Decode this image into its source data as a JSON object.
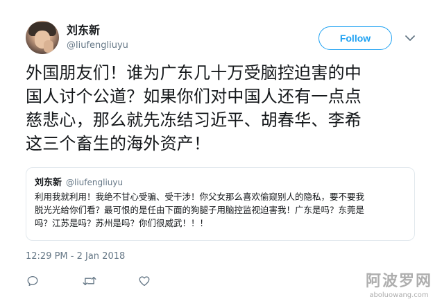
{
  "author": {
    "name": "刘东新",
    "handle": "@liufengliuyu"
  },
  "follow_label": "Follow",
  "tweet": {
    "line1": "外国朋友们！谁为广东几十万受脑控迫害的中",
    "line2": "国人讨个公道？如果你们对中国人还有一点点",
    "line3": "慈悲心，那么就先冻结习近平、胡春华、李希",
    "line4": "这三个畜生的海外资产！"
  },
  "quoted_tweet": {
    "name": "刘东新",
    "handle": "@liufengliuyu",
    "line1": "利用我就利用！我绝不甘心受骗、受干涉！你父女那么喜欢偷窥别人的隐私，要不要我",
    "line2": "脱光光给你们看？最可恨的是任由下面的狗腿子用脑控监视迫害我！广东是吗？东莞是",
    "line3": "吗？江苏是吗？苏州是吗？你们很威武！！！"
  },
  "timestamp": "12:29 PM - 2 Jan 2018",
  "actions": [
    "reply-icon",
    "retweet-icon",
    "like-icon"
  ],
  "watermark": {
    "main": "阿波罗网",
    "sub": "aboluowang.com"
  },
  "colors": {
    "accent": "#1da1f2",
    "secondary_text": "#657786",
    "border": "#e1e8ed"
  }
}
